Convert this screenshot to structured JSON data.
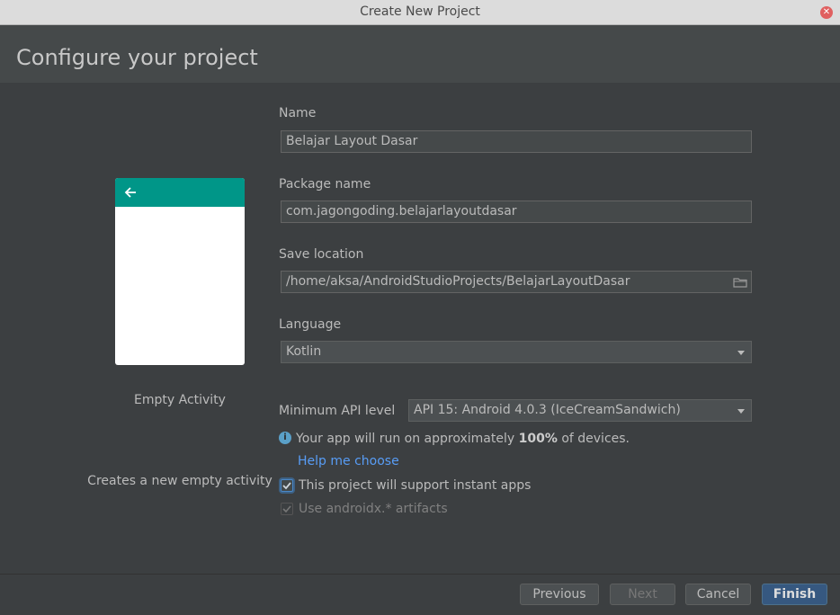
{
  "window": {
    "title": "Create New Project"
  },
  "header": {
    "title": "Configure your project"
  },
  "template": {
    "name": "Empty Activity",
    "description": "Creates a new empty activity",
    "toolbar_color": "#009688"
  },
  "form": {
    "name_label": "Name",
    "name_value": "Belajar Layout Dasar",
    "package_label": "Package name",
    "package_value": "com.jagongoding.belajarlayoutdasar",
    "save_label": "Save location",
    "save_value": "/home/aksa/AndroidStudioProjects/BelajarLayoutDasar",
    "language_label": "Language",
    "language_value": "Kotlin",
    "min_api_label": "Minimum API level",
    "min_api_value": "API 15: Android 4.0.3 (IceCreamSandwich)",
    "info_pre": "Your app will run on approximately ",
    "info_bold": "100%",
    "info_post": " of devices.",
    "help_link": "Help me choose",
    "instant_apps_label": "This project will support instant apps",
    "instant_apps_checked": true,
    "androidx_label": "Use androidx.* artifacts",
    "androidx_checked": true
  },
  "buttons": {
    "previous": "Previous",
    "next": "Next",
    "cancel": "Cancel",
    "finish": "Finish"
  },
  "colors": {
    "accent": "#365880",
    "link": "#589df6",
    "background": "#3c3f41"
  }
}
